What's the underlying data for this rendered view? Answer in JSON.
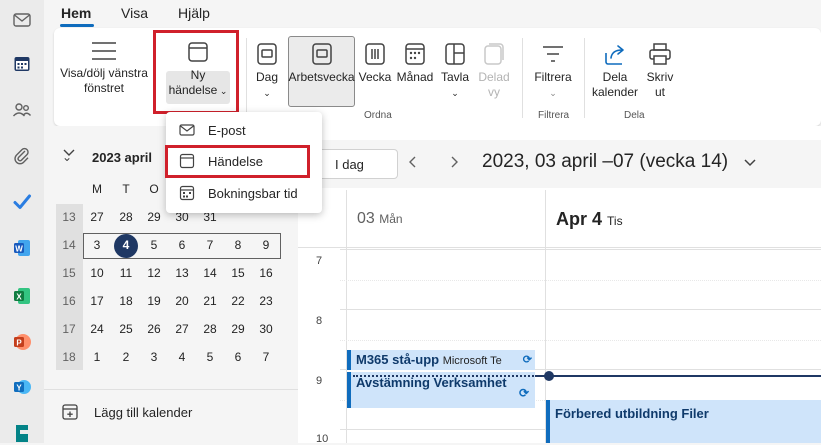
{
  "ribbon_tabs": [
    "Hem",
    "Visa",
    "Hjälp"
  ],
  "ribbon": {
    "toggle_pane_label_1": "Visa/dölj vänstra",
    "toggle_pane_label_2": "fönstret",
    "new_event_label_1": "Ny",
    "new_event_label_2": "händelse",
    "day_label": "Dag",
    "workweek_label": "Arbetsvecka",
    "week_label": "Vecka",
    "month_label": "Månad",
    "board_label": "Tavla",
    "split_label_1": "Delad",
    "split_label_2": "vy",
    "filter_label": "Filtrera",
    "share_label_1": "Dela",
    "share_label_2": "kalender",
    "print_label_1": "Skriv",
    "print_label_2": "ut",
    "group_arrange": "Ordna",
    "group_filter": "Filtrera",
    "group_share": "Dela"
  },
  "dropdown": {
    "email": "E-post",
    "event": "Händelse",
    "bookable": "Bokningsbar tid"
  },
  "mini_calendar": {
    "month_title": "2023 april",
    "weekday_headers": [
      "M",
      "T",
      "O",
      "T",
      "F"
    ],
    "weeks": [
      {
        "week": "13",
        "days": [
          "27",
          "28",
          "29",
          "30",
          "31"
        ]
      },
      {
        "week": "14",
        "days": [
          "3",
          "4",
          "5",
          "6",
          "7",
          "8",
          "9"
        ]
      },
      {
        "week": "15",
        "days": [
          "10",
          "11",
          "12",
          "13",
          "14",
          "15",
          "16"
        ]
      },
      {
        "week": "16",
        "days": [
          "17",
          "18",
          "19",
          "20",
          "21",
          "22",
          "23"
        ]
      },
      {
        "week": "17",
        "days": [
          "24",
          "25",
          "26",
          "27",
          "28",
          "29",
          "30"
        ]
      },
      {
        "week": "18",
        "days": [
          "1",
          "2",
          "3",
          "4",
          "5",
          "6",
          "7"
        ]
      }
    ],
    "today": "4"
  },
  "add_calendar": "Lägg till kalender",
  "toolbar": {
    "today_button": "I dag",
    "range_title": "2023, 03 april –07 (vecka 14)"
  },
  "days": [
    {
      "num": "03",
      "name": "Mån"
    },
    {
      "num": "Apr 4",
      "name": "Tis"
    }
  ],
  "hours": [
    "7",
    "8",
    "9",
    "10"
  ],
  "events": [
    {
      "title": "M365 stå-upp",
      "sub": "Microsoft Te"
    },
    {
      "title": "Avstämning Verksamhet",
      "sub": ""
    },
    {
      "title": "Förbered utbildning Filer",
      "sub": ""
    }
  ],
  "colors": {
    "accent": "#0f6cbd",
    "highlight": "#d0202b",
    "event_bg": "#cfe4fa"
  }
}
